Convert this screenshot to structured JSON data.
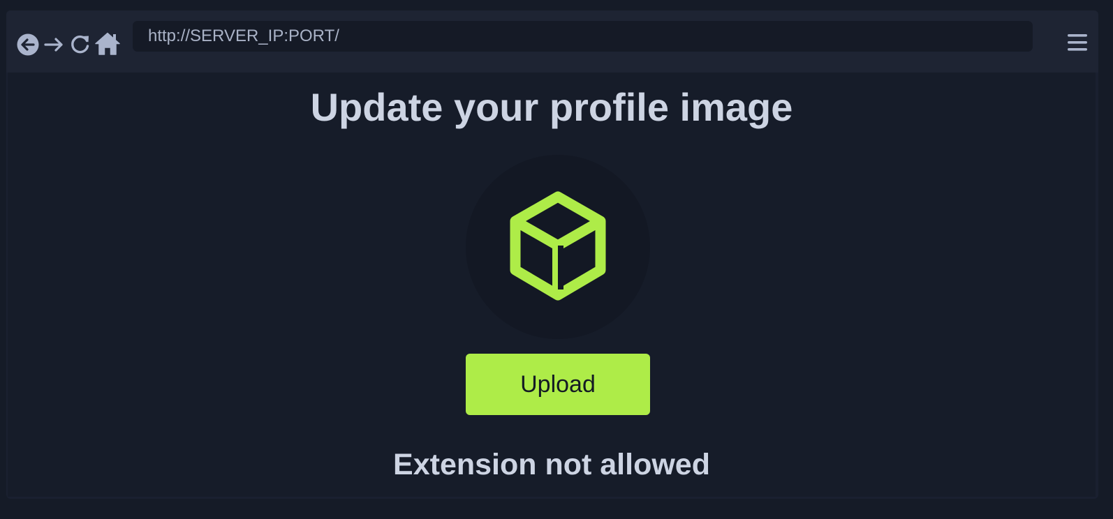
{
  "browser": {
    "url": "http://SERVER_IP:PORT/",
    "icons": {
      "back": "back-arrow-circle-icon",
      "forward": "forward-arrow-icon",
      "reload": "reload-icon",
      "home": "home-icon",
      "menu": "hamburger-menu-icon"
    }
  },
  "page": {
    "title": "Update your profile image",
    "avatar_icon": "cube-icon",
    "upload_label": "Upload",
    "status": "Extension not allowed"
  },
  "colors": {
    "accent": "#aeec48",
    "background": "#161c29",
    "text": "#cdd4e3",
    "toolbar": "#1e2433"
  }
}
